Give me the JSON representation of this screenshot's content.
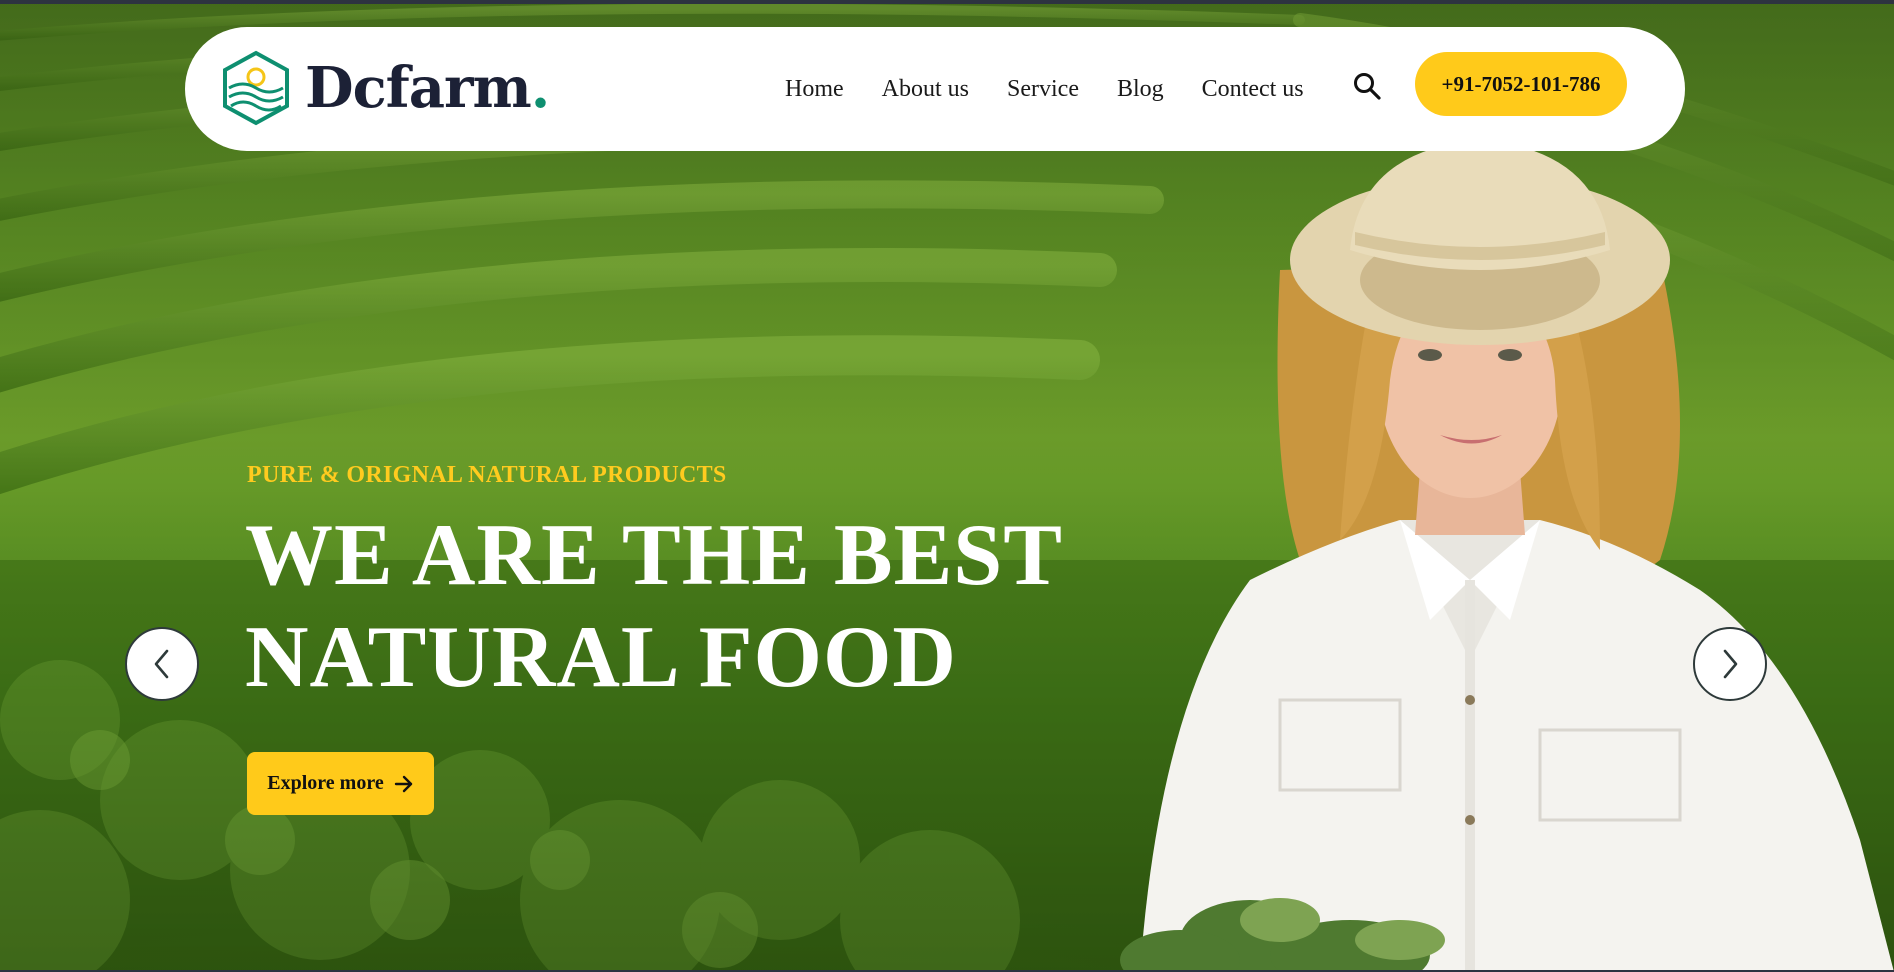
{
  "header": {
    "logo_text": "Dcfarm",
    "logo_dot": ".",
    "nav": [
      {
        "label": "Home"
      },
      {
        "label": "About us"
      },
      {
        "label": "Service"
      },
      {
        "label": "Blog"
      },
      {
        "label": "Contect us"
      }
    ],
    "search_icon": "search-icon",
    "phone": "+91-7052-101-786"
  },
  "hero": {
    "tagline": "PURE & ORIGNAL NATURAL PRODUCTS",
    "headline_line1": "WE ARE THE BEST",
    "headline_line2": "NATURAL FOOD",
    "cta_label": "Explore more",
    "cta_icon": "arrow-right-icon",
    "prev_icon": "chevron-left-icon",
    "next_icon": "chevron-right-icon"
  },
  "colors": {
    "accent": "#ffca1a",
    "logo_dark": "#1c2136",
    "logo_green": "#0e8f70",
    "field_green": "#5c8f24",
    "white": "#ffffff"
  }
}
